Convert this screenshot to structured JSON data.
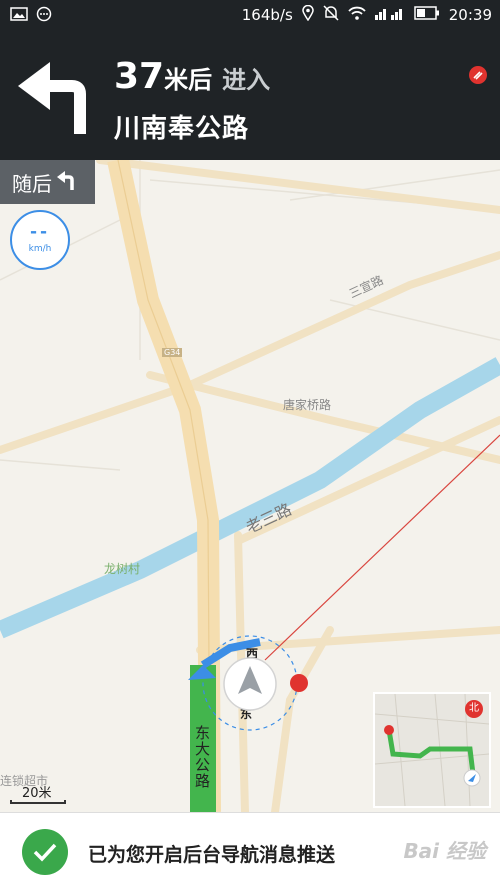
{
  "status_bar": {
    "left_icons": [
      "image-icon",
      "message-icon"
    ],
    "net_speed": "164b/s",
    "right_icons": [
      "location-icon",
      "mute-icon",
      "wifi-icon",
      "signal-icon",
      "battery-icon"
    ],
    "time": "20:39"
  },
  "nav": {
    "distance_num": "37",
    "distance_unit": "米后",
    "action": "进入",
    "road_name": "川南奉公路",
    "turn_icon": "turn-left-icon"
  },
  "map": {
    "next_turn_label": "随后",
    "speed_value": "--",
    "speed_unit": "km/h",
    "labels": {
      "sanzao": "三宣路",
      "tangjia": "唐家桥路",
      "laosan": "老三路",
      "longshu": "龙树村",
      "dongda": "东大公路",
      "west": "西",
      "east": "东",
      "chain_store": "连锁超市",
      "highway_tag": "G34"
    },
    "scale": "20米",
    "minimap_north": "北"
  },
  "toast": {
    "text": "已为您开启后台导航消息推送",
    "watermark": "Bai 经验"
  },
  "colors": {
    "bar_bg": "#1f2326",
    "route_green": "#43b54d",
    "water": "#a7d6ea",
    "road_yellow": "#f5deb0",
    "accent_blue": "#3c8ee6"
  }
}
